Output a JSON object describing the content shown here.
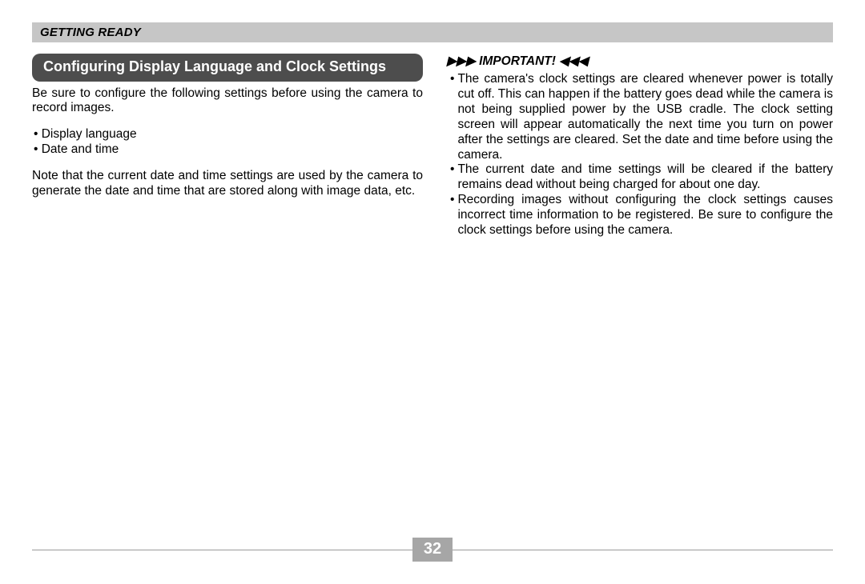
{
  "header": "GETTING READY",
  "left": {
    "section_title": "Configuring Display Language and Clock Settings",
    "intro": "Be sure to configure the following settings before using the camera to record images.",
    "bullets": [
      "Display language",
      "Date and time"
    ],
    "note": "Note that the current date and time settings are used by the camera to generate the date and time that are stored along with image data, etc."
  },
  "right": {
    "important_label_left": "▶▶▶",
    "important_label_text": "IMPORTANT!",
    "important_label_right": "◀◀◀",
    "items": [
      "The camera's clock settings are cleared whenever power is totally cut off. This can happen if the battery goes dead while the camera is not being supplied power by the USB cradle.   The clock setting screen will appear automatically the next time you turn on power after the settings are cleared. Set the date and time before using the camera.",
      "The current date and time settings will be cleared if the battery remains dead without being charged for about one day.",
      "Recording images without configuring the clock settings causes incorrect time information to be registered. Be sure to configure the clock settings before using the camera."
    ]
  },
  "page_number": "32"
}
